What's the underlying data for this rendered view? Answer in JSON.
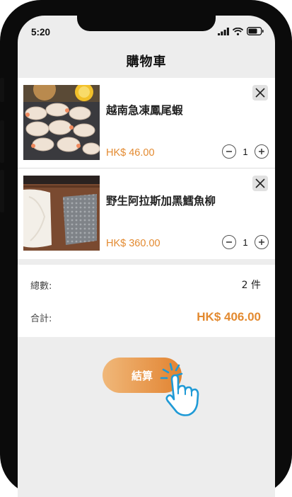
{
  "status_bar": {
    "time": "5:20"
  },
  "header": {
    "title": "購物車"
  },
  "cart": {
    "items": [
      {
        "name": "越南急凍鳳尾蝦",
        "price": "HK$ 46.00",
        "quantity": "1"
      },
      {
        "name": "野生阿拉斯加黑鱈魚柳",
        "price": "HK$ 360.00",
        "quantity": "1"
      }
    ]
  },
  "summary": {
    "count_label": "總數:",
    "count_value": "2 件",
    "total_label": "合計:",
    "total_value": "HK$ 406.00"
  },
  "checkout": {
    "label": "結算"
  },
  "colors": {
    "accent": "#e38a30",
    "background": "#ededed",
    "panel": "#ffffff",
    "tap_hint": "#1f9ad6"
  },
  "icons": [
    "close-icon",
    "minus-icon",
    "plus-icon",
    "tap-hand-icon",
    "signal-icon",
    "wifi-icon",
    "battery-icon"
  ]
}
